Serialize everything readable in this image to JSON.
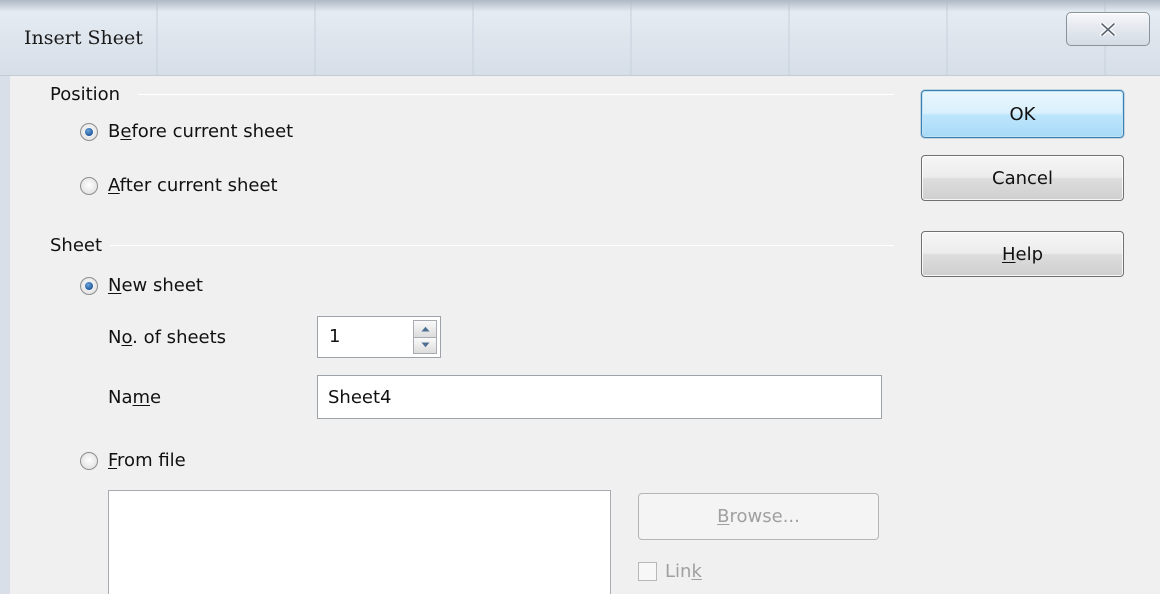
{
  "dialog": {
    "title": "Insert Sheet",
    "close_icon": "close-x-icon"
  },
  "position": {
    "group_label": "Position",
    "options": [
      {
        "pre": "B",
        "mnemonic": "e",
        "post": "fore current sheet",
        "selected": true
      },
      {
        "pre": "",
        "mnemonic": "A",
        "post": "fter current sheet",
        "selected": false
      }
    ]
  },
  "sheet": {
    "group_label": "Sheet",
    "new_sheet": {
      "pre": "",
      "mnemonic": "N",
      "post": "ew sheet",
      "selected": true
    },
    "count_label": {
      "pre": "N",
      "mnemonic": "o",
      "post": ". of sheets"
    },
    "count_value": "1",
    "name_label": {
      "pre": "Na",
      "mnemonic": "m",
      "post": "e"
    },
    "name_value": "Sheet4",
    "from_file": {
      "pre": "",
      "mnemonic": "F",
      "post": "rom file",
      "selected": false
    },
    "browse": {
      "pre": "",
      "mnemonic": "B",
      "post": "rowse...",
      "enabled": false
    },
    "link": {
      "pre": "Lin",
      "mnemonic": "k",
      "post": "",
      "checked": false,
      "enabled": false
    }
  },
  "buttons": {
    "ok": {
      "pre": "",
      "mnemonic": "",
      "post": "OK"
    },
    "cancel": {
      "pre": "",
      "mnemonic": "",
      "post": "Cancel"
    },
    "help": {
      "pre": "",
      "mnemonic": "H",
      "post": "elp"
    }
  },
  "colors": {
    "default_button_border": "#3c7fb1",
    "radio_dot": "#1f5aa0",
    "disabled_text": "#a0a0a0"
  }
}
